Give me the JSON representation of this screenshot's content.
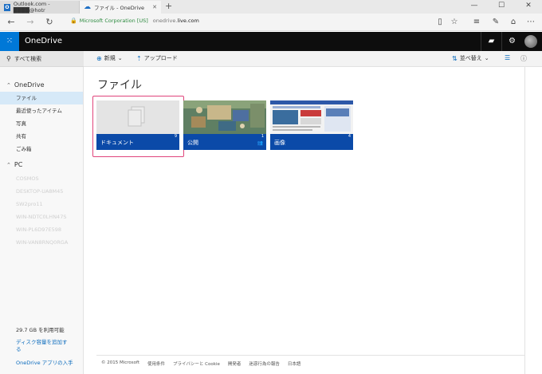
{
  "browser": {
    "tabs": [
      {
        "title": "Outlook.com - ████@hotr",
        "active": false
      },
      {
        "title": "ファイル - OneDrive",
        "active": true
      }
    ],
    "new_tab": "+",
    "address": {
      "cert": "Microsoft Corporation [US]",
      "url_prefix": "onedrive.",
      "url_host": "live.com"
    }
  },
  "app": {
    "title": "OneDrive",
    "search_label": "すべて検索",
    "commands": {
      "new_label": "新規",
      "upload_label": "アップロード",
      "sort_label": "並べ替え"
    }
  },
  "sidebar": {
    "onedrive_label": "OneDrive",
    "items": [
      {
        "label": "ファイル",
        "selected": true
      },
      {
        "label": "最近使ったアイテム",
        "selected": false
      },
      {
        "label": "写真",
        "selected": false
      },
      {
        "label": "共有",
        "selected": false
      },
      {
        "label": "ごみ箱",
        "selected": false
      }
    ],
    "pc_label": "PC",
    "pcs": [
      "COSMOS",
      "DESKTOP-UA8M45",
      "SW2pro11",
      "WIN-NDTC0LHN47S",
      "WIN-PL6D97E598",
      "WIN-VAN8RNQ0RGA"
    ],
    "storage": "29.7 GB を利用可能",
    "add_storage": "ディスク容量を追加する",
    "get_app": "OneDrive アプリの入手"
  },
  "main": {
    "title": "ファイル",
    "tiles": [
      {
        "name": "ドキュメント",
        "count": "9"
      },
      {
        "name": "公開",
        "count": "1"
      },
      {
        "name": "画像",
        "count": "4"
      }
    ],
    "footer": [
      "© 2015 Microsoft",
      "使用条件",
      "プライバシーと Cookie",
      "開発者",
      "迷惑行為の報告",
      "日本語"
    ]
  },
  "colors": {
    "accent": "#0078d7",
    "tile_label": "#0b4aa8",
    "selection": "#e0457b"
  }
}
